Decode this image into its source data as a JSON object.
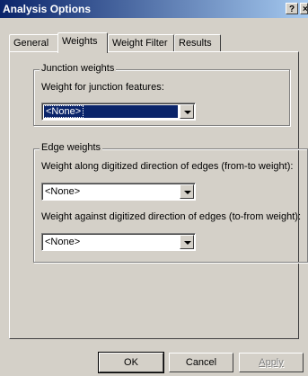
{
  "window": {
    "title": "Analysis Options",
    "help_glyph": "?",
    "close_glyph": "×"
  },
  "tabs": [
    {
      "label": "General"
    },
    {
      "label": "Weights"
    },
    {
      "label": "Weight Filter"
    },
    {
      "label": "Results"
    }
  ],
  "junction_group": {
    "legend": "Junction weights",
    "label": "Weight for junction features:",
    "value": "<None>"
  },
  "edge_group": {
    "legend": "Edge weights",
    "from_to_label": "Weight along digitized direction of edges (from-to weight):",
    "from_to_value": "<None>",
    "to_from_label": "Weight against digitized direction of edges (to-from weight):",
    "to_from_value": "<None>"
  },
  "buttons": {
    "ok": "OK",
    "cancel": "Cancel",
    "apply": "Apply"
  }
}
